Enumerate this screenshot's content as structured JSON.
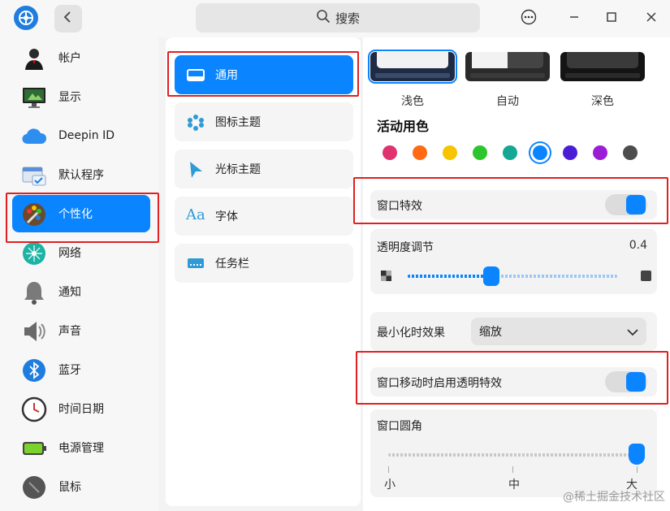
{
  "titlebar": {
    "search_placeholder": "搜索",
    "back_icon": "chevron-left-icon",
    "menu_icon": "more-icon",
    "min_icon": "minimize-icon",
    "max_icon": "maximize-icon",
    "close_icon": "close-icon"
  },
  "sidebar": {
    "items": [
      {
        "label": "帐户",
        "icon": "account-icon"
      },
      {
        "label": "显示",
        "icon": "display-icon"
      },
      {
        "label": "Deepin ID",
        "icon": "cloud-icon"
      },
      {
        "label": "默认程序",
        "icon": "default-apps-icon"
      },
      {
        "label": "个性化",
        "icon": "personalization-icon",
        "selected": true
      },
      {
        "label": "网络",
        "icon": "network-icon"
      },
      {
        "label": "通知",
        "icon": "bell-icon"
      },
      {
        "label": "声音",
        "icon": "speaker-icon"
      },
      {
        "label": "蓝牙",
        "icon": "bluetooth-icon"
      },
      {
        "label": "时间日期",
        "icon": "clock-icon"
      },
      {
        "label": "电源管理",
        "icon": "battery-icon"
      },
      {
        "label": "鼠标",
        "icon": "mouse-icon"
      }
    ]
  },
  "submenu": {
    "items": [
      {
        "label": "通用",
        "icon": "window-icon",
        "selected": true
      },
      {
        "label": "图标主题",
        "icon": "icon-theme-icon"
      },
      {
        "label": "光标主题",
        "icon": "cursor-icon"
      },
      {
        "label": "字体",
        "icon": "font-icon"
      },
      {
        "label": "任务栏",
        "icon": "taskbar-icon"
      }
    ]
  },
  "general": {
    "themes": [
      "浅色",
      "自动",
      "深色"
    ],
    "accent_title": "活动用色",
    "accent_colors": [
      "#e0326e",
      "#ff6a13",
      "#f6c500",
      "#2dc52d",
      "#14a894",
      "#0a84ff",
      "#4b1ed6",
      "#9b1ed6",
      "#4d4d4d"
    ],
    "accent_selected_index": 5,
    "window_effect": {
      "label": "窗口特效",
      "enabled": true
    },
    "transparency": {
      "label": "透明度调节",
      "value": "0.4",
      "fraction": 0.4
    },
    "minimize_effect": {
      "label": "最小化时效果",
      "value": "缩放"
    },
    "move_transparency": {
      "label": "窗口移动时启用透明特效",
      "enabled": true
    },
    "corner": {
      "label": "窗口圆角",
      "ticks": [
        "小",
        "中",
        "大"
      ],
      "fraction": 1.0
    }
  },
  "watermark": "@稀土掘金技术社区"
}
